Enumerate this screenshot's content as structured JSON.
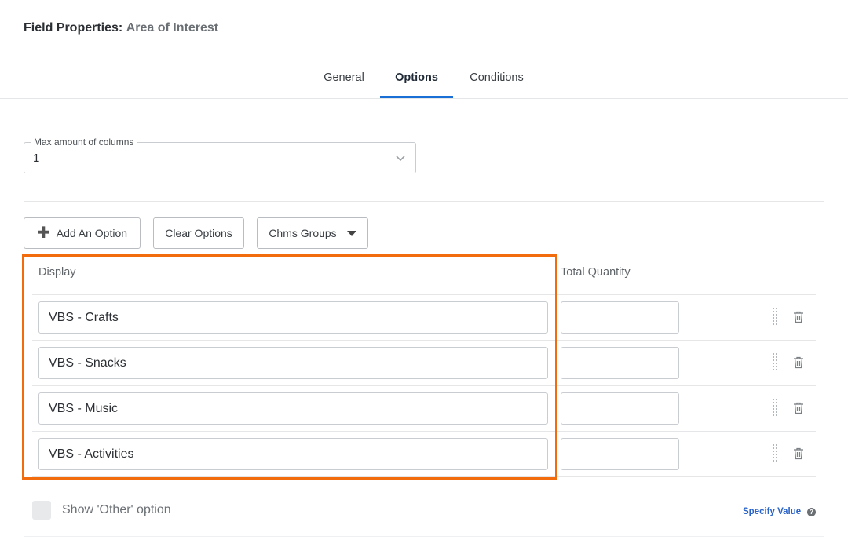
{
  "header": {
    "label": "Field Properties:",
    "value": "Area of Interest"
  },
  "tabs": [
    {
      "label": "General",
      "active": false
    },
    {
      "label": "Options",
      "active": true
    },
    {
      "label": "Conditions",
      "active": false
    }
  ],
  "columns_select": {
    "legend": "Max amount of columns",
    "value": "1"
  },
  "toolbar": {
    "add_label": "Add An Option",
    "clear_label": "Clear Options",
    "chms_label": "Chms Groups"
  },
  "table": {
    "headers": {
      "display": "Display",
      "quantity": "Total Quantity"
    },
    "rows": [
      {
        "display": "VBS - Crafts",
        "quantity": ""
      },
      {
        "display": "VBS - Snacks",
        "quantity": ""
      },
      {
        "display": "VBS - Music",
        "quantity": ""
      },
      {
        "display": "VBS - Activities",
        "quantity": ""
      }
    ]
  },
  "other_option": {
    "label": "Show 'Other' option",
    "checked": false
  },
  "specify": {
    "label": "Specify Value",
    "help_glyph": "?"
  },
  "colors": {
    "accent": "#1a6fd6",
    "highlight": "#f26c0d",
    "link": "#2a63c8"
  },
  "icons": [
    "plus-icon",
    "chevron-down-icon",
    "caret-down-icon",
    "drag-handle-icon",
    "trash-icon",
    "help-icon"
  ]
}
